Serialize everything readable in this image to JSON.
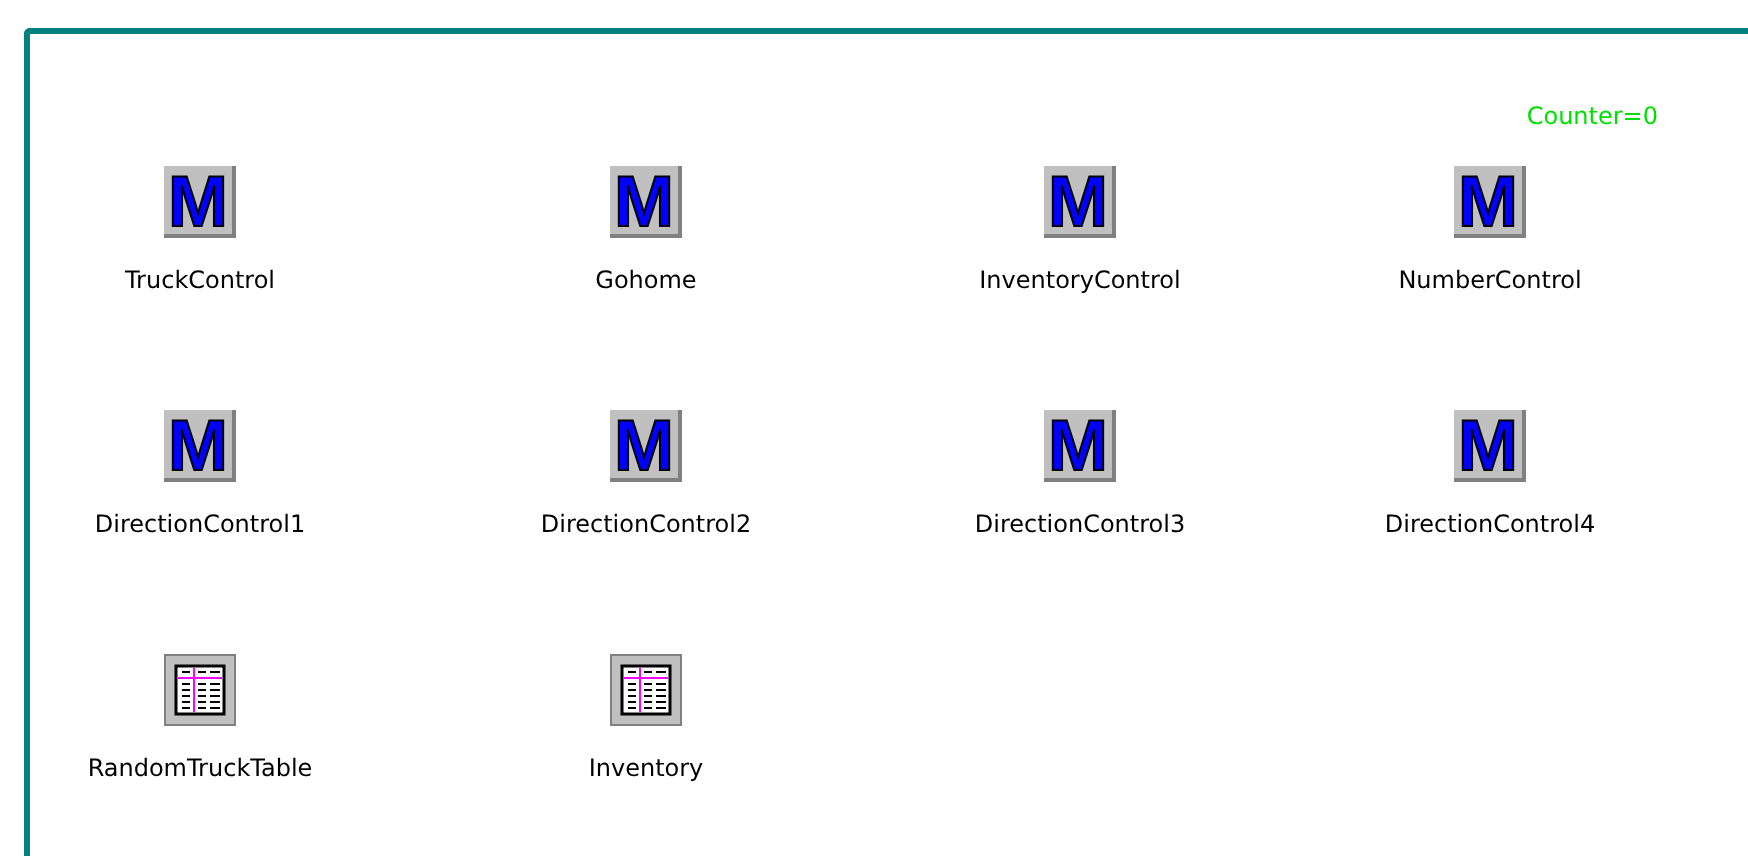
{
  "counter": "Counter=0",
  "items": [
    {
      "kind": "module",
      "glyph": "M",
      "label": "TruckControl"
    },
    {
      "kind": "module",
      "glyph": "M",
      "label": "Gohome"
    },
    {
      "kind": "module",
      "glyph": "M",
      "label": "InventoryControl"
    },
    {
      "kind": "module",
      "glyph": "M",
      "label": "NumberControl"
    },
    {
      "kind": "module",
      "glyph": "M",
      "label": "DirectionControl1"
    },
    {
      "kind": "module",
      "glyph": "M",
      "label": "DirectionControl2"
    },
    {
      "kind": "module",
      "glyph": "M",
      "label": "DirectionControl3"
    },
    {
      "kind": "module",
      "glyph": "M",
      "label": "DirectionControl4"
    },
    {
      "kind": "table",
      "label": "RandomTruckTable"
    },
    {
      "kind": "table",
      "label": "Inventory"
    }
  ]
}
